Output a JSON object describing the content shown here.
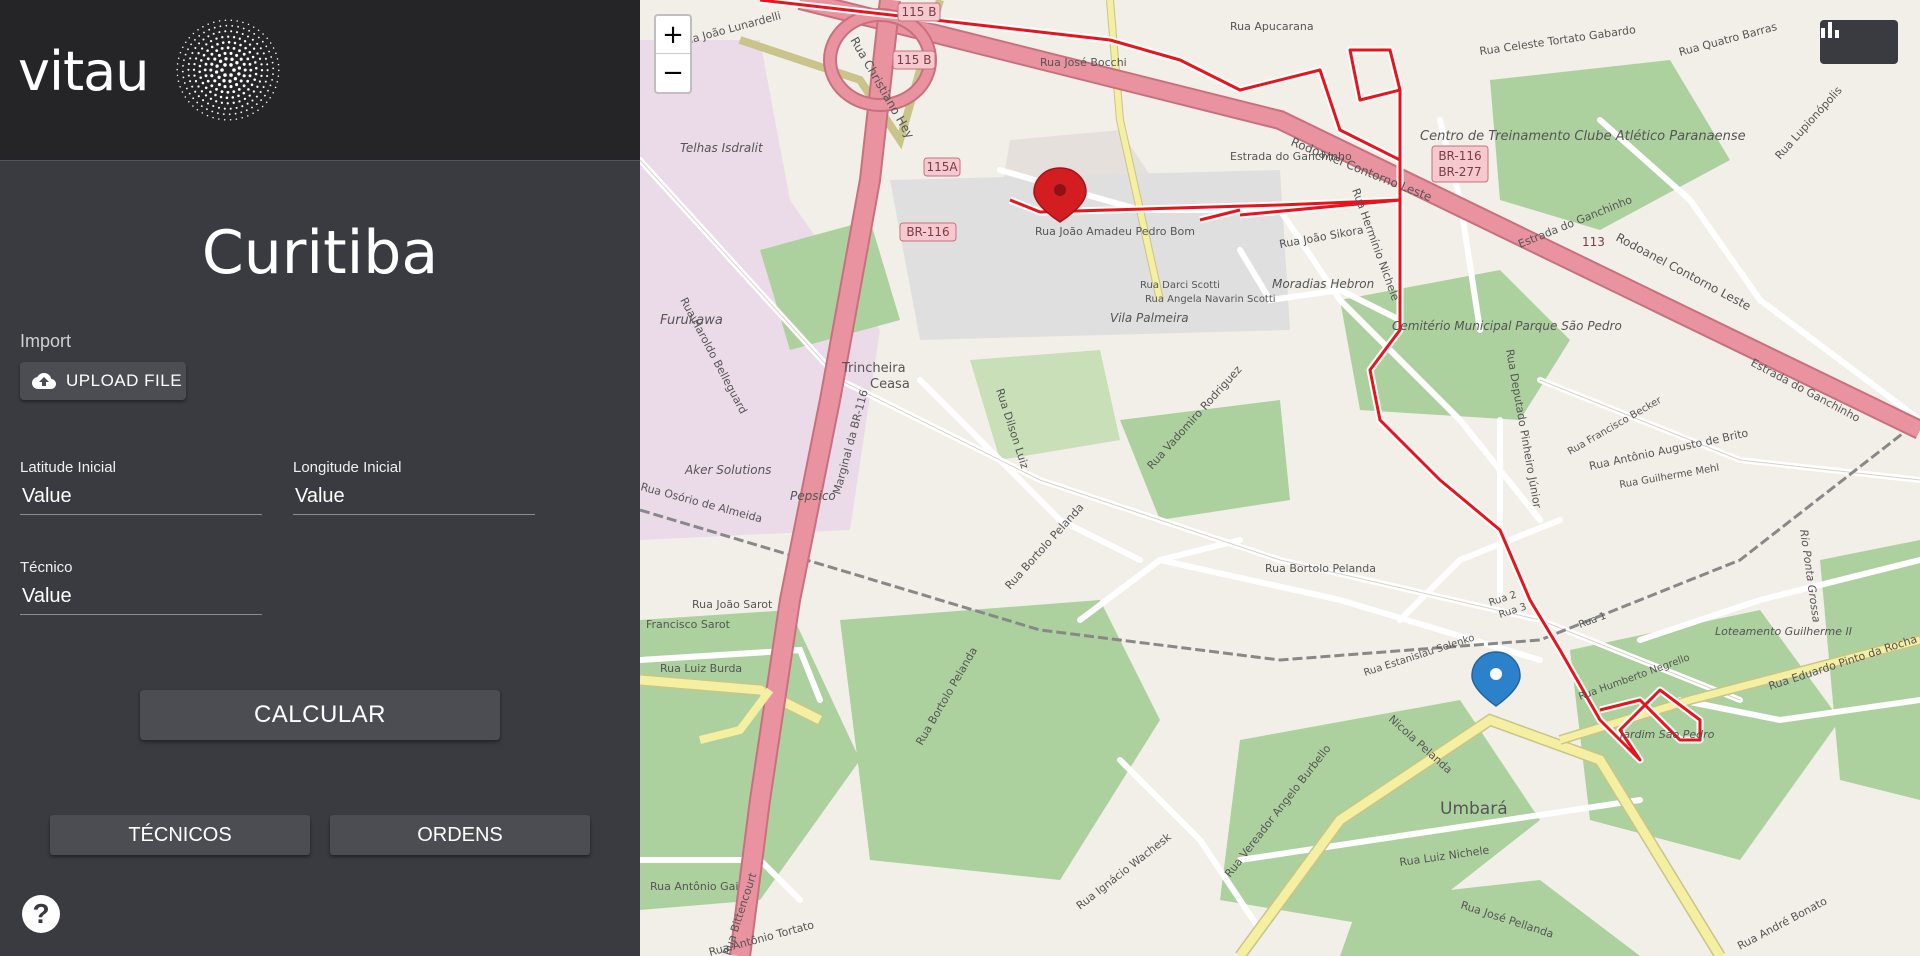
{
  "app": {
    "logo_text": "vitau",
    "city": "Curitiba"
  },
  "import": {
    "label": "Import",
    "upload_label": "UPLOAD FILE"
  },
  "fields": {
    "latitude": {
      "label": "Latitude Inicial",
      "placeholder": "Value"
    },
    "longitude": {
      "label": "Longitude Inicial",
      "placeholder": "Value"
    },
    "tecnico": {
      "label": "Técnico",
      "placeholder": "Value"
    }
  },
  "buttons": {
    "calcular": "CALCULAR",
    "tecnicos": "TÉCNICOS",
    "ordens": "ORDENS",
    "help": "?"
  },
  "map": {
    "zoom_in": "+",
    "zoom_out": "−",
    "labels": {
      "telhas": "Telhas Isdralit",
      "furukawa": "Furukawa",
      "trincheira": "Trincheira",
      "ceasa": "Ceasa",
      "aker": "Aker Solutions",
      "pepsico": "Pepsico",
      "cemiterio": "Cemitério Municipal Parque São Pedro",
      "centro": "Centro de Treinamento Clube Atlético Paranaense",
      "moradias": "Moradias Hebron",
      "vila": "Vila Palmeira",
      "loteamento": "Loteamento Guilherme II",
      "jardim": "Jardim São Pedro",
      "umbara": "Umbará",
      "br116": "BR-116",
      "br116b": "BR-116",
      "br277": "BR-277",
      "r115b": "115 B",
      "r115b2": "115 B",
      "r115a": "115A",
      "r113": "113",
      "rodoanel": "Rodoanel Contorno Leste",
      "rodoanel2": "Rodoanel Contorno Leste",
      "christiano": "Rua Christiano Hey",
      "lunardelli": "Rua João Lunardelli",
      "bocchi": "Rua José Bocchi",
      "ganchinho": "Estrada do Ganchinho",
      "ganchinho2": "Estrada do Ganchinho",
      "ganchinho3": "Estrada do Ganchinho",
      "amadeu": "Rua João Amadeu Pedro Bom",
      "sikora": "Rua João Sikora",
      "nichele": "Rua Hermínio Nichele",
      "scotti": "Rua Darci Scotti",
      "navarin": "Rua Angela Navarin Scotti",
      "marginal": "Marginal da BR-116",
      "dilson": "Rua Dilson Luiz",
      "vadomiro": "Rua Vadomiro Rodriguez",
      "pelanda": "Rua Bortolo Pelanda",
      "pelanda2": "Rua Bortolo Pelanda",
      "pelanda3": "Rua Bortolo Pelanda",
      "belleguard": "Rua Haroldo Belleguard",
      "sarot": "Rua João Sarot",
      "sarot2": "Francisco Sarot",
      "burda": "Rua Luiz Burda",
      "almeida": "Rua Osório de Almeida",
      "burbello": "Rua Vereador Angelo Burbello",
      "nicolapelanda": "Nicola Pelanda",
      "luiznichele": "Rua Luiz Nichele",
      "wachesk": "Rua Ignácio Wachesk",
      "tortato": "Rua Antônio Tortato",
      "pellanda": "Rua José Pellanda",
      "bonato": "Rua André Bonato",
      "selenko": "Rua Estanislau Selenko",
      "negrello": "Rua Humberto Negrello",
      "eduardo": "Rua Eduardo Pinto da Rocha",
      "pinheiro": "Rua Deputado Pinheiro Júnior",
      "augusto": "Rua Antônio Augusto de Brito",
      "mehl": "Rua Guilherme Mehl",
      "becker": "Rua Francisco Becker",
      "apucarana": "Rua Apucarana",
      "quatro": "Rua Quatro Barras",
      "celeste": "Rua Celeste Tortato Gabardo",
      "rua1": "Rua 1",
      "rua2": "Rua 2",
      "rua3": "Rua 3",
      "ribeiro": "Rio Ponta Grossa",
      "biguacu": "Rua Lupionópolis",
      "gai": "Rua Antônio Gai",
      "bittencourt": "Rua Bittencourt"
    }
  },
  "colors": {
    "route": "#e8131b",
    "highway": "#e992a0",
    "highway_stroke": "#c8707e",
    "minor_road": "#ffffff",
    "trunk_yellow": "#f4efa1",
    "green": "#add19e",
    "landuse_industrial": "#ebdbe8",
    "marker_red": "#d31d21",
    "marker_blue": "#2b82cb"
  }
}
